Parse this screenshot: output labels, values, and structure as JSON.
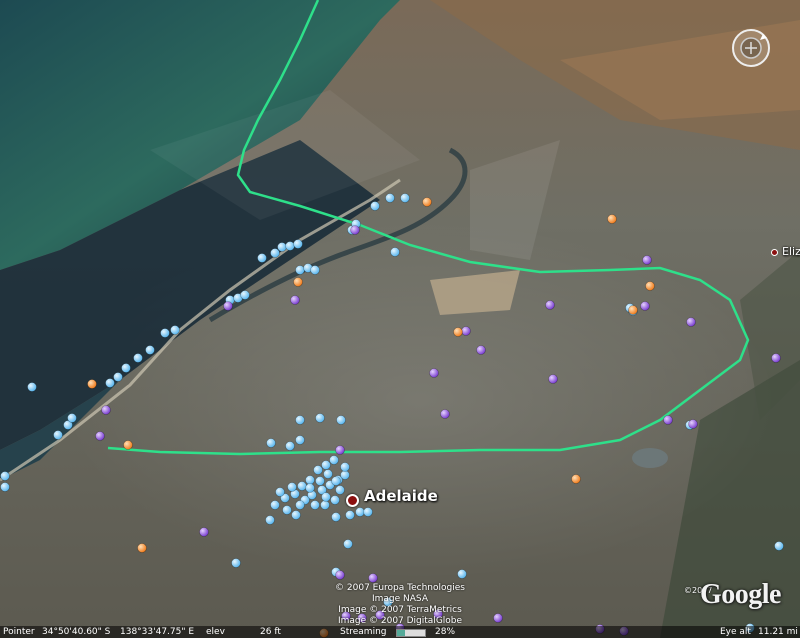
{
  "map": {
    "places": {
      "primary": "Adelaide",
      "secondary": "Eliz"
    }
  },
  "attribution": {
    "lines": [
      "© 2007 Europa Technologies",
      "Image NASA",
      "Image © 2007 TerraMetrics",
      "Image © 2007 DigitalGlobe"
    ]
  },
  "logo": {
    "copyright": "©2007",
    "text": "Google"
  },
  "status": {
    "pointer_label": "Pointer",
    "pointer_lat": "34°50'40.60\" S",
    "pointer_lon": "138°33'47.75\" E",
    "elev_label": "elev",
    "elev_value": "26 ft",
    "streaming_label": "Streaming",
    "streaming_value": "28%",
    "streaming_fraction": 0.28,
    "eye_alt_label": "Eye alt",
    "eye_alt_value": "11.21 mi"
  },
  "colors": {
    "route": "#2ee08a",
    "marker_blue": "#8fd4ff",
    "marker_purple": "#9b5fe0",
    "marker_orange": "#ff9a3c",
    "city_marker": "#8b1010"
  }
}
